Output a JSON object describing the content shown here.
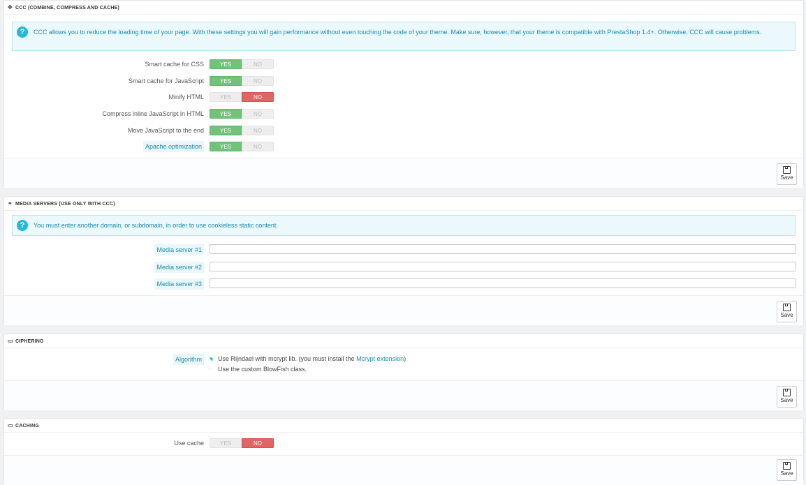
{
  "ccc": {
    "title": "CCC (COMBINE, COMPRESS AND CACHE)",
    "icon": "move-arrows-icon",
    "info": "CCC allows you to reduce the loading time of your page. With these settings you will gain performance without even touching the code of your theme. Make sure, however, that your theme is compatible with PrestaShop 1.4+. Otherwise, CCC will cause problems.",
    "options": [
      {
        "label": "Smart cache for CSS",
        "value": "YES"
      },
      {
        "label": "Smart cache for JavaScript",
        "value": "YES"
      },
      {
        "label": "Minify HTML",
        "value": "NO"
      },
      {
        "label": "Compress inline JavaScript in HTML",
        "value": "YES"
      },
      {
        "label": "Move JavaScript to the end",
        "value": "YES"
      },
      {
        "label": "Apache optimization",
        "value": "YES"
      }
    ],
    "save_label": "Save"
  },
  "switch_labels": {
    "yes": "YES",
    "no": "NO"
  },
  "media": {
    "title": "MEDIA SERVERS (USE ONLY WITH CCC)",
    "icon": "link-icon",
    "info": "You must enter another domain, or subdomain, in order to use cookieless static content.",
    "servers": [
      {
        "label": "Media server #1",
        "value": ""
      },
      {
        "label": "Media server #2",
        "value": ""
      },
      {
        "label": "Media server #3",
        "value": ""
      }
    ],
    "save_label": "Save"
  },
  "ciphering": {
    "title": "CIPHERING",
    "icon": "monitor-icon",
    "algorithm_label": "Algorithm",
    "option1_text": "Use Rijndael with mcrypt lib. (you must install the ",
    "option1_link": "Mcrypt extension",
    "option1_suffix": ")",
    "option2_text": "Use the custom BlowFish class.",
    "selected": "option1",
    "save_label": "Save"
  },
  "caching": {
    "title": "CACHING",
    "icon": "monitor-icon",
    "use_cache_label": "Use cache",
    "use_cache_value": "NO",
    "save_label": "Save"
  },
  "colors": {
    "yes_active": "#72c279",
    "no_active": "#e06666",
    "info_bg": "#ebf8fc",
    "info_text": "#1b8ba8"
  }
}
